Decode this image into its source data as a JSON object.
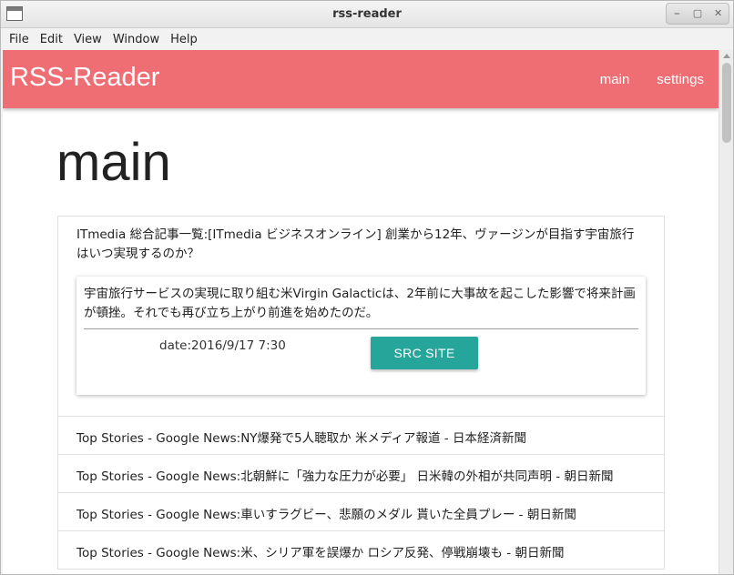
{
  "window": {
    "title": "rss-reader",
    "controls": [
      "minimize",
      "maximize",
      "close"
    ]
  },
  "menubar": {
    "items": [
      "File",
      "Edit",
      "View",
      "Window",
      "Help"
    ]
  },
  "appbar": {
    "brand": "RSS-Reader",
    "nav": [
      "main",
      "settings"
    ],
    "color": "#ef6e73"
  },
  "page": {
    "title": "main"
  },
  "articles": {
    "expanded": {
      "headline": "ITmedia 総合記事一覧:[ITmedia ビジネスオンライン] 創業から12年、ヴァージンが目指す宇宙旅行はいつ実現するのか？",
      "description": "宇宙旅行サービスの実現に取り組む米Virgin Galacticは、2年前に大事故を起こした影響で将来計画が頓挫。それでも再び立ち上がり前進を始めたのだ。",
      "date": "date:2016/9/17 7:30",
      "button_label": "SRC SITE",
      "button_color": "#26a69a"
    },
    "items": [
      "Top Stories - Google News:NY爆発で5人聴取か 米メディア報道 - 日本経済新聞",
      "Top Stories - Google News:北朝鮮に「強力な圧力が必要」 日米韓の外相が共同声明 - 朝日新聞",
      "Top Stories - Google News:車いすラグビー、悲願のメダル 貰いた全員プレー - 朝日新聞",
      "Top Stories - Google News:米、シリア軍を誤爆か ロシア反発、停戦崩壊も - 朝日新聞"
    ]
  }
}
